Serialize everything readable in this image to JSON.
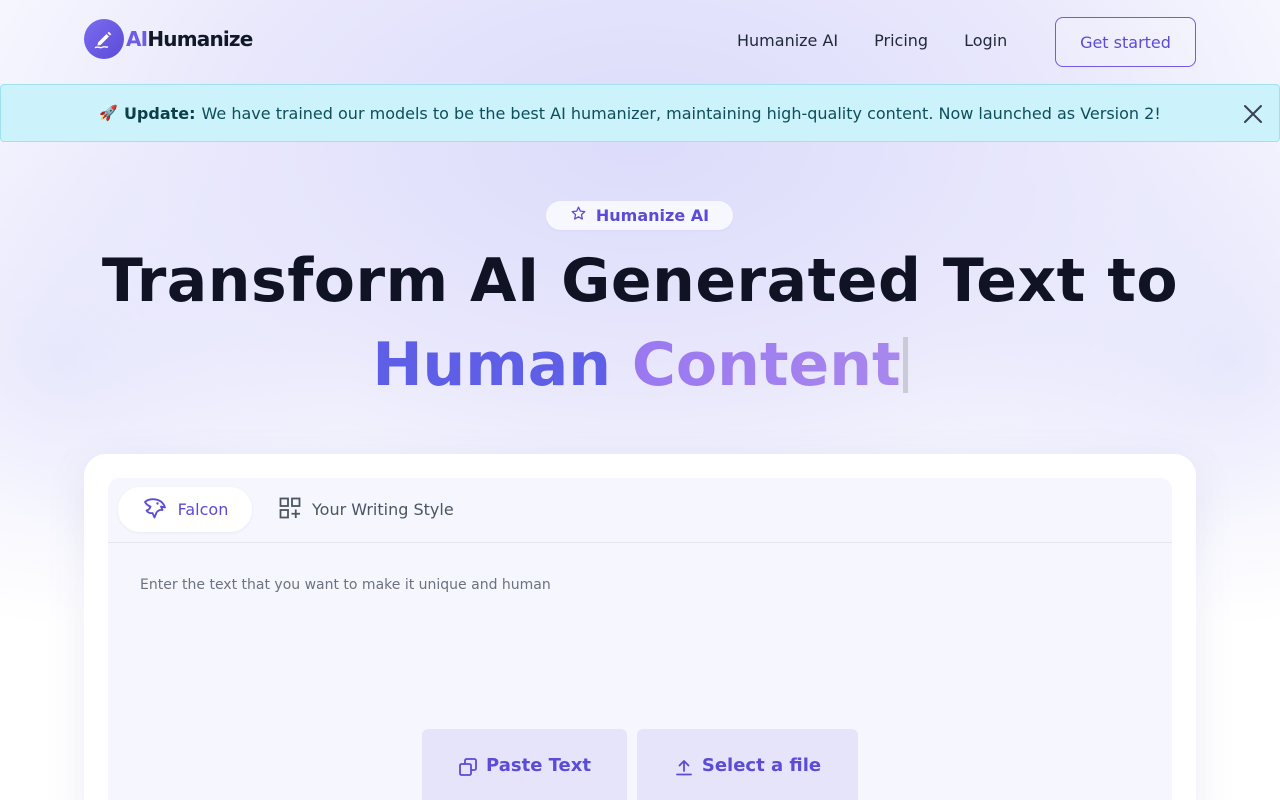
{
  "nav": {
    "logo_ai": "AI",
    "logo_rest": "Humanize",
    "links": [
      "Humanize AI",
      "Pricing",
      "Login"
    ],
    "cta": "Get started"
  },
  "banner": {
    "emoji": "🚀",
    "label": "Update:",
    "message": "We have trained our models to be the best AI humanizer, maintaining high-quality content. Now launched as Version 2!"
  },
  "hero": {
    "badge": "Humanize AI",
    "title": "Transform AI Generated Text to",
    "subtitle_part1": "Human",
    "subtitle_part2": "Content"
  },
  "editor": {
    "tabs": [
      "Falcon",
      "Your Writing Style"
    ],
    "active_tab": "Falcon",
    "placeholder": "Enter the text that you want to make it unique and human",
    "paste_label": "Paste Text",
    "file_label": "Select a file"
  },
  "colors": {
    "accent": "#5b4bd6",
    "banner_bg": "#ccf2fb",
    "hero_grad_start": "#5f5ee6",
    "hero_grad_end": "#a887ee"
  },
  "icons": [
    "logo-pen-icon",
    "close-icon",
    "star-icon",
    "falcon-bird-icon",
    "grid-plus-icon",
    "copy-icon",
    "upload-icon"
  ]
}
